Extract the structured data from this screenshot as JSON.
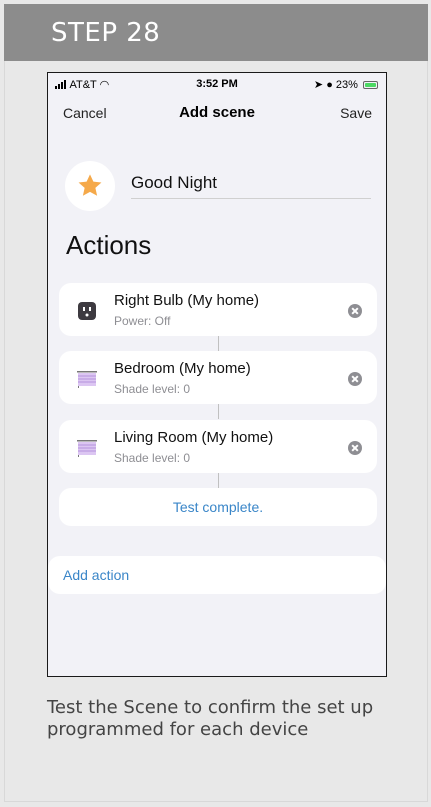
{
  "step": {
    "title": "STEP 28"
  },
  "status_bar": {
    "carrier": "AT&T",
    "time": "3:52 PM",
    "battery": "23%"
  },
  "nav": {
    "cancel": "Cancel",
    "title": "Add scene",
    "save": "Save"
  },
  "scene": {
    "icon": "star-icon",
    "name": "Good Night"
  },
  "actions": {
    "title": "Actions",
    "items": [
      {
        "name": "Right Bulb (My home)",
        "status": "Power: Off",
        "icon": "outlet-icon"
      },
      {
        "name": "Bedroom (My home)",
        "status": "Shade level: 0",
        "icon": "shade-icon"
      },
      {
        "name": "Living Room (My home)",
        "status": "Shade level: 0",
        "icon": "shade-icon"
      }
    ],
    "test_label": "Test complete.",
    "add_label": "Add action"
  },
  "caption": "Test the Scene to confirm the set up programmed for each device",
  "colors": {
    "accent": "#3a86c8",
    "header_bg": "#8c8c8c",
    "star": "#f5a94a"
  }
}
